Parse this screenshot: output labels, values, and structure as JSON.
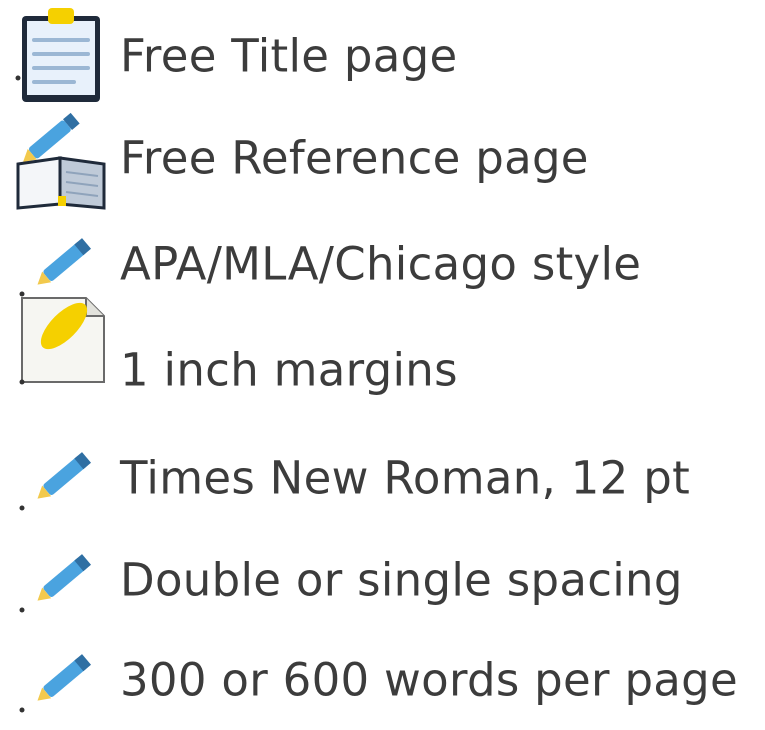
{
  "features": [
    {
      "label": "Free Title page",
      "icon": "clipboard-icon"
    },
    {
      "label": "Free Reference page",
      "icon": "open-book-icon"
    },
    {
      "label": "APA/MLA/Chicago style",
      "icon": "pencil-icon"
    },
    {
      "label": "1 inch margins",
      "icon": "page-corner-icon"
    },
    {
      "label": "Times New Roman, 12 pt",
      "icon": "pencil-icon"
    },
    {
      "label": "Double or single spacing",
      "icon": "pencil-icon"
    },
    {
      "label": "300 or 600 words per page",
      "icon": "pencil-icon"
    }
  ],
  "colors": {
    "text": "#3c3c3c",
    "pencil_blue": "#4aa3df",
    "pencil_tip": "#f2c94c",
    "clipboard_frame": "#1f2a3a",
    "paper": "#e8f1fb",
    "yellow_accent": "#f5d000"
  }
}
